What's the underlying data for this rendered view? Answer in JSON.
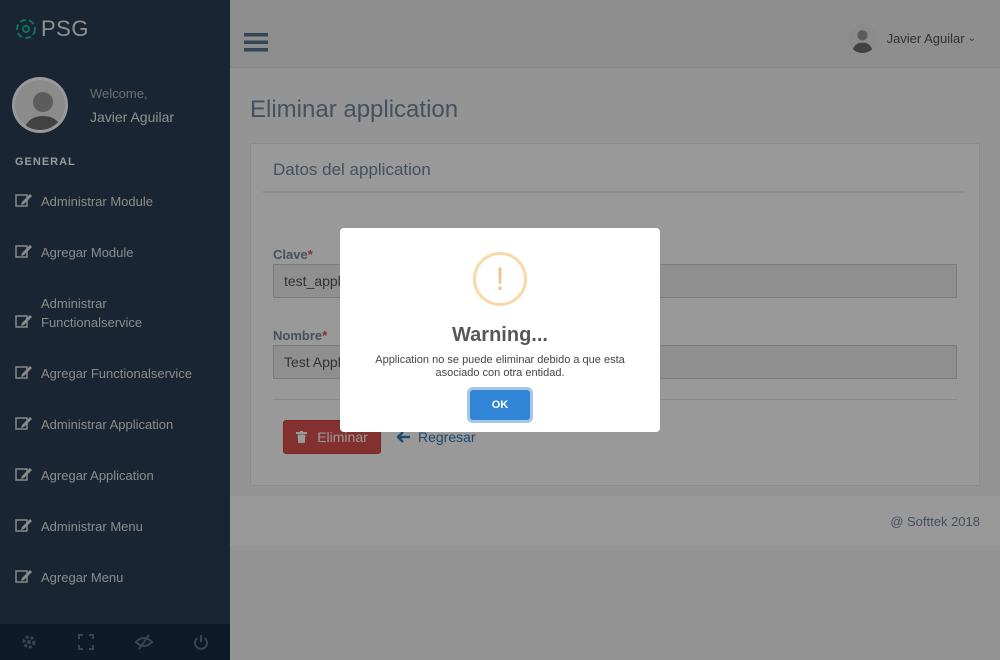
{
  "brand": {
    "name": "PSG"
  },
  "profile": {
    "welcome": "Welcome,",
    "name": "Javier Aguilar"
  },
  "sidebar": {
    "section_title": "GENERAL",
    "items": [
      {
        "label": "Administrar Module"
      },
      {
        "label": "Agregar Module"
      },
      {
        "label": "Administrar Functionalservice"
      },
      {
        "label": "Agregar Functionalservice"
      },
      {
        "label": "Administrar Application"
      },
      {
        "label": "Agregar Application"
      },
      {
        "label": "Administrar Menu"
      },
      {
        "label": "Agregar Menu"
      }
    ],
    "footer_icons": [
      "settings-icon",
      "fullscreen-icon",
      "hide-icon",
      "power-icon"
    ]
  },
  "topnav": {
    "user_name": "Javier Aguilar"
  },
  "page": {
    "title": "Eliminar application",
    "panel_title": "Datos del application",
    "fields": [
      {
        "label": "Clave",
        "required_mark": "*",
        "value": "test_application"
      },
      {
        "label": "Nombre",
        "required_mark": "*",
        "value": "Test Application"
      }
    ],
    "delete_label": "Eliminar",
    "back_label": "Regresar",
    "footer": "@ Softtek 2018"
  },
  "modal": {
    "icon_glyph": "!",
    "title": "Warning...",
    "message": "Application no se puede eliminar debido a que esta asociado con otra entidad.",
    "ok_label": "OK"
  },
  "colors": {
    "sidebar": "#2a3f54",
    "danger": "#d9534f",
    "link": "#337ab7",
    "ok_button": "#3085d6",
    "warning_icon": "#F5C08D"
  }
}
